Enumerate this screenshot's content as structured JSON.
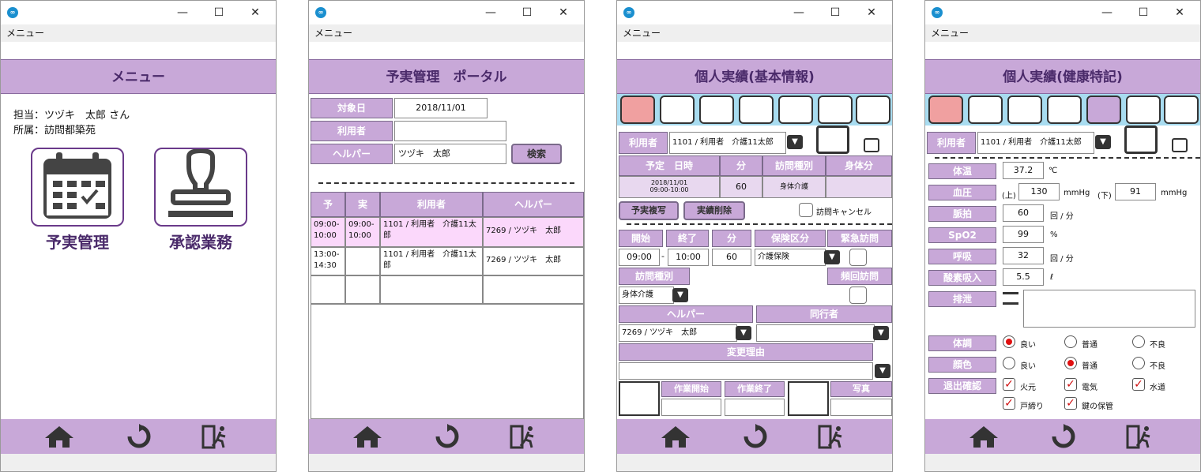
{
  "menu_label": "メニュー",
  "win1": {
    "title": "メニュー",
    "staff_line": "担当：ツヅキ　太郎 さん",
    "affiliation_line": "所属：訪問都築苑",
    "tile1_label": "予実管理",
    "tile2_label": "承認業務"
  },
  "win2": {
    "title": "予実管理　ポータル",
    "target_date_label": "対象日",
    "target_date": "2018/11/01",
    "user_label": "利用者",
    "user_value": "",
    "helper_label": "ヘルパー",
    "helper_value": "ツヅキ　太郎",
    "search_button": "検索",
    "table_headers": [
      "予",
      "実",
      "利用者",
      "ヘルパー"
    ],
    "rows": [
      {
        "plan": "09:00-10:00",
        "actual": "09:00-10:00",
        "user": "1101 / 利用者　介護11太郎",
        "helper": "7269 / ツヅキ　太郎"
      },
      {
        "plan": "13:00-14:30",
        "actual": "",
        "user": "1101 / 利用者　介護11太郎",
        "helper": "7269 / ツヅキ　太郎"
      }
    ]
  },
  "win3": {
    "title": "個人実績(基本情報)",
    "user_label": "利用者",
    "user_value": "1101 / 利用者　介護11太郎",
    "sched_headers": [
      "予定　日時",
      "分",
      "訪問種別",
      "身体分"
    ],
    "sched_date": "2018/11/01",
    "sched_time": "09:00-10:00",
    "sched_minutes": "60",
    "sched_type": "身体介護",
    "copy_button": "予実複写",
    "delete_button": "実績削除",
    "cancel_label": "訪問キャンセル",
    "start_label": "開始",
    "end_label": "終了",
    "min_label": "分",
    "insurance_label": "保険区分",
    "urgent_label": "緊急訪問",
    "start_value": "09:00",
    "dash": "-",
    "end_value": "10:00",
    "min_value": "60",
    "insurance_value": "介護保険",
    "visit_type_label": "訪問種別",
    "frequent_label": "頻回訪問",
    "visit_type_value": "身体介護",
    "helper_label": "ヘルパー",
    "companion_label": "同行者",
    "helper_value": "7269 / ツヅキ　太郎",
    "reason_label": "変更理由",
    "work_start_label": "作業開始",
    "work_end_label": "作業終了",
    "photo_label": "写真"
  },
  "win4": {
    "title": "個人実績(健康特記)",
    "user_label": "利用者",
    "user_value": "1101 / 利用者　介護11太郎",
    "temp_label": "体温",
    "temp_value": "37.2",
    "temp_unit": "℃",
    "bp_label": "血圧",
    "bp_upper_label": "(上)",
    "bp_upper": "130",
    "bp_unit1": "mmHg",
    "bp_lower_label": "(下)",
    "bp_lower": "91",
    "bp_unit2": "mmHg",
    "pulse_label": "脈拍",
    "pulse_value": "60",
    "pulse_unit": "回 / 分",
    "spo2_label": "SpO2",
    "spo2_value": "99",
    "spo2_unit": "%",
    "resp_label": "呼吸",
    "resp_value": "32",
    "resp_unit": "回 / 分",
    "oxygen_label": "酸素吸入",
    "oxygen_value": "5.5",
    "oxygen_unit": "ℓ",
    "excretion_label": "排泄",
    "condition_label": "体調",
    "complexion_label": "顔色",
    "opt_good": "良い",
    "opt_normal": "普通",
    "opt_bad": "不良",
    "exit_label": "退出確認",
    "chk_fire": "火元",
    "chk_elec": "電気",
    "chk_water": "水道",
    "chk_lock": "戸締り",
    "chk_key": "鍵の保管"
  }
}
